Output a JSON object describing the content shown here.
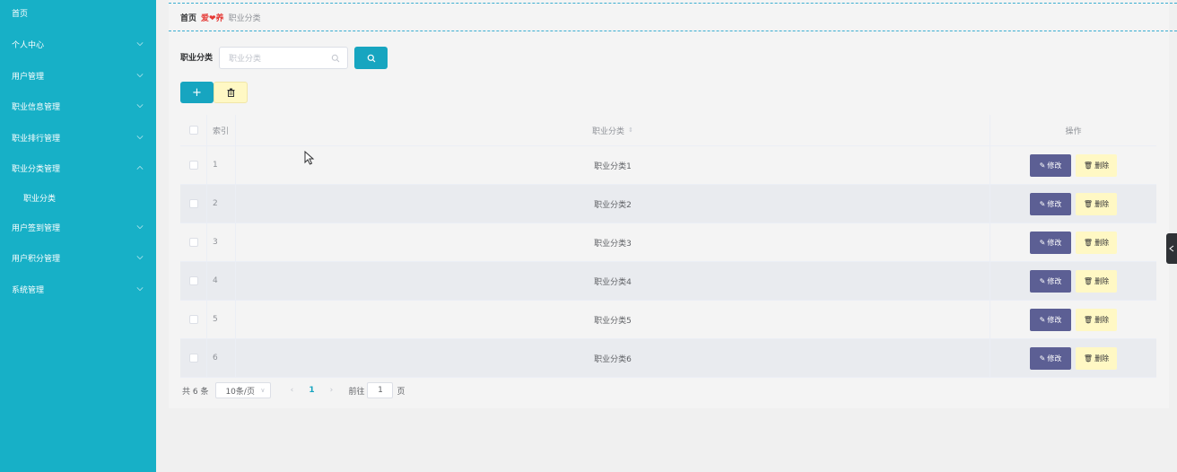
{
  "sidebar": {
    "items": [
      {
        "label": "首页",
        "chevron": ""
      },
      {
        "label": "个人中心",
        "chevron": "down"
      },
      {
        "label": "用户管理",
        "chevron": "down"
      },
      {
        "label": "职业信息管理",
        "chevron": "down"
      },
      {
        "label": "职业排行管理",
        "chevron": "down"
      },
      {
        "label": "职业分类管理",
        "chevron": "up"
      },
      {
        "label": "职业分类",
        "chevron": ""
      },
      {
        "label": "用户签到管理",
        "chevron": "down"
      },
      {
        "label": "用户积分管理",
        "chevron": "down"
      },
      {
        "label": "系统管理",
        "chevron": "down"
      }
    ]
  },
  "breadcrumb": {
    "home": "首页",
    "separator": "爱❤养",
    "current": "职业分类"
  },
  "search": {
    "label": "职业分类",
    "placeholder": "职业分类"
  },
  "table": {
    "headers": {
      "index": "索引",
      "name": "职业分类",
      "operation": "操作"
    },
    "rows": [
      {
        "index": "1",
        "name": "职业分类1"
      },
      {
        "index": "2",
        "name": "职业分类2"
      },
      {
        "index": "3",
        "name": "职业分类3"
      },
      {
        "index": "4",
        "name": "职业分类4"
      },
      {
        "index": "5",
        "name": "职业分类5"
      },
      {
        "index": "6",
        "name": "职业分类6"
      }
    ],
    "edit_label": "修改",
    "delete_label": "删除"
  },
  "toolbar": {
    "add_label": "+"
  },
  "pagination": {
    "total": "共 6 条",
    "page_size": "10条/页",
    "current_page": "1",
    "goto_label": "前往",
    "goto_value": "1",
    "page_suffix": "页"
  },
  "colors": {
    "sidebar": "#17b0c7",
    "primary": "#17a5c0",
    "edit": "#5c5f94",
    "delete": "#fff8c4"
  }
}
